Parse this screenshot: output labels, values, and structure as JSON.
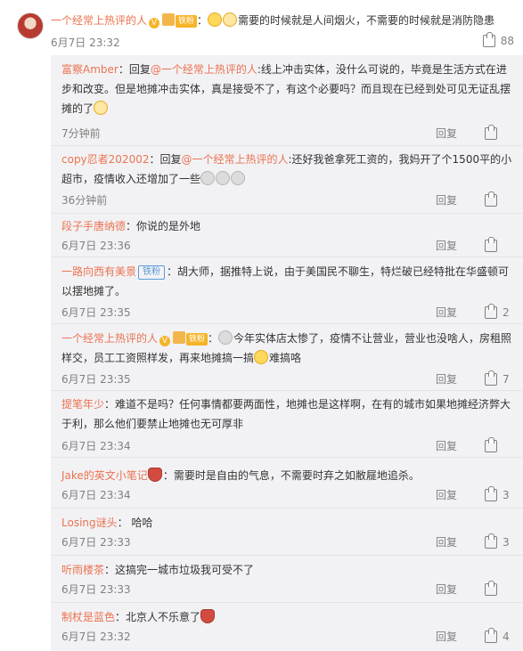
{
  "main_comment": {
    "username": "一个经常上热评的人",
    "badge": "铁粉",
    "text": "需要的时候就是人间烟火，不需要的时候就是消防隐患",
    "time": "6月7日 23:32",
    "likes": "88"
  },
  "replies": [
    {
      "username": "富察Amber",
      "prefix": "：回复",
      "mention": "@一个经常上热评的人",
      "text": ":线上冲击实体，没什么可说的，毕竟是生活方式在进步和改变。但是地摊冲击实体，真是接受不了，有这个必要吗？而且现在已经到处可见无证乱摆摊的了",
      "time": "7分钟前",
      "reply": "回复",
      "likes": ""
    },
    {
      "username": "copy忍者202002",
      "prefix": "：回复",
      "mention": "@一个经常上热评的人",
      "text": ":还好我爸拿死工资的，我妈开了个1500平的小超市，疫情收入还增加了一些",
      "time": "36分钟前",
      "reply": "回复",
      "likes": ""
    },
    {
      "username": "段子手唐纳德",
      "text": "：你说的是外地",
      "time": "6月7日 23:36",
      "reply": "回复",
      "likes": ""
    },
    {
      "username": "一路向西有美景",
      "badge": "铁粉",
      "text": "：胡大师，据推特上说，由于美国民不聊生，特烂破已经特批在华盛顿可以摆地摊了。",
      "time": "6月7日 23:35",
      "reply": "回复",
      "likes": "2"
    },
    {
      "username": "一个经常上热评的人",
      "badge": "铁粉",
      "text_before": "今年实体店太惨了，疫情不让营业，营业也没啥人，房租照样交，员工工资照样发，再来地摊搞一搞",
      "text_after": "难搞咯",
      "time": "6月7日 23:35",
      "reply": "回复",
      "likes": "7"
    },
    {
      "username": "提笔年少",
      "text": "：难道不是吗？任何事情都要两面性，地摊也是这样啊，在有的城市如果地摊经济弊大于利，那么他们要禁止地摊也无可厚非",
      "time": "6月7日 23:34",
      "reply": "回复",
      "likes": ""
    },
    {
      "username": "Jake的英文小笔记",
      "text": "：需要时是自由的气息，不需要时弃之如敝屣地追杀。",
      "time": "6月7日 23:34",
      "reply": "回复",
      "likes": "3"
    },
    {
      "username": "Losing谜头",
      "text": "：  哈哈",
      "time": "6月7日 23:33",
      "reply": "回复",
      "likes": "3"
    },
    {
      "username": "听雨楼茶",
      "text": "：这搞完一城市垃圾我可受不了",
      "time": "6月7日 23:33",
      "reply": "回复",
      "likes": ""
    },
    {
      "username": "制杖是蓝色",
      "text": "：北京人不乐意了",
      "time": "6月7日 23:32",
      "reply": "回复",
      "likes": "4"
    }
  ]
}
